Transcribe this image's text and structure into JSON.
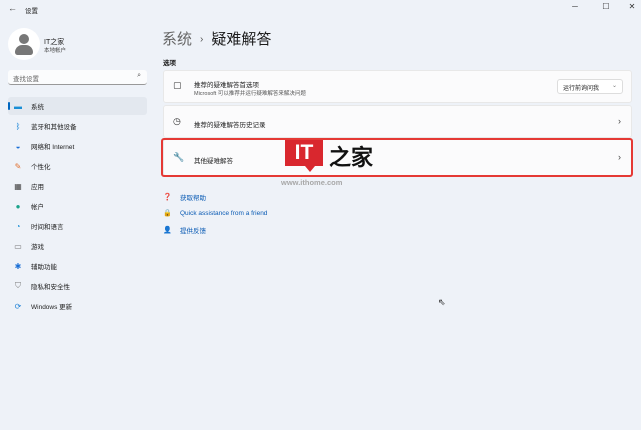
{
  "window": {
    "title": "设置",
    "minimize": "─",
    "maximize": "☐",
    "close": "✕"
  },
  "user": {
    "name": "IT之家",
    "type": "本地帐户"
  },
  "search": {
    "placeholder": "查找设置"
  },
  "nav": [
    {
      "label": "系统",
      "icon": "display-icon",
      "selected": true
    },
    {
      "label": "蓝牙和其他设备",
      "icon": "bluetooth-icon"
    },
    {
      "label": "网络和 Internet",
      "icon": "wifi-icon"
    },
    {
      "label": "个性化",
      "icon": "brush-icon"
    },
    {
      "label": "应用",
      "icon": "apps-icon"
    },
    {
      "label": "帐户",
      "icon": "account-icon"
    },
    {
      "label": "时间和语言",
      "icon": "globe-clock-icon"
    },
    {
      "label": "游戏",
      "icon": "gamepad-icon"
    },
    {
      "label": "辅助功能",
      "icon": "accessibility-icon"
    },
    {
      "label": "隐私和安全性",
      "icon": "shield-icon"
    },
    {
      "label": "Windows 更新",
      "icon": "update-icon"
    }
  ],
  "breadcrumb": {
    "parent": "系统",
    "current": "疑难解答"
  },
  "section": "选项",
  "cards": [
    {
      "title": "推荐的疑难解答首选项",
      "subtitle": "Microsoft 可以推荐并运行疑难解答来解决问题",
      "dropdown": "运行前询问我"
    },
    {
      "title": "推荐的疑难解答历史记录"
    },
    {
      "title": "其他疑难解答"
    }
  ],
  "links": [
    "获取帮助",
    "Quick assistance from a friend",
    "提供反馈"
  ],
  "watermark": {
    "logo": "IT",
    "brand": "之家",
    "url": "www.ithome.com"
  },
  "colors": {
    "accent": "#0067c0",
    "highlight": "#e53935"
  }
}
